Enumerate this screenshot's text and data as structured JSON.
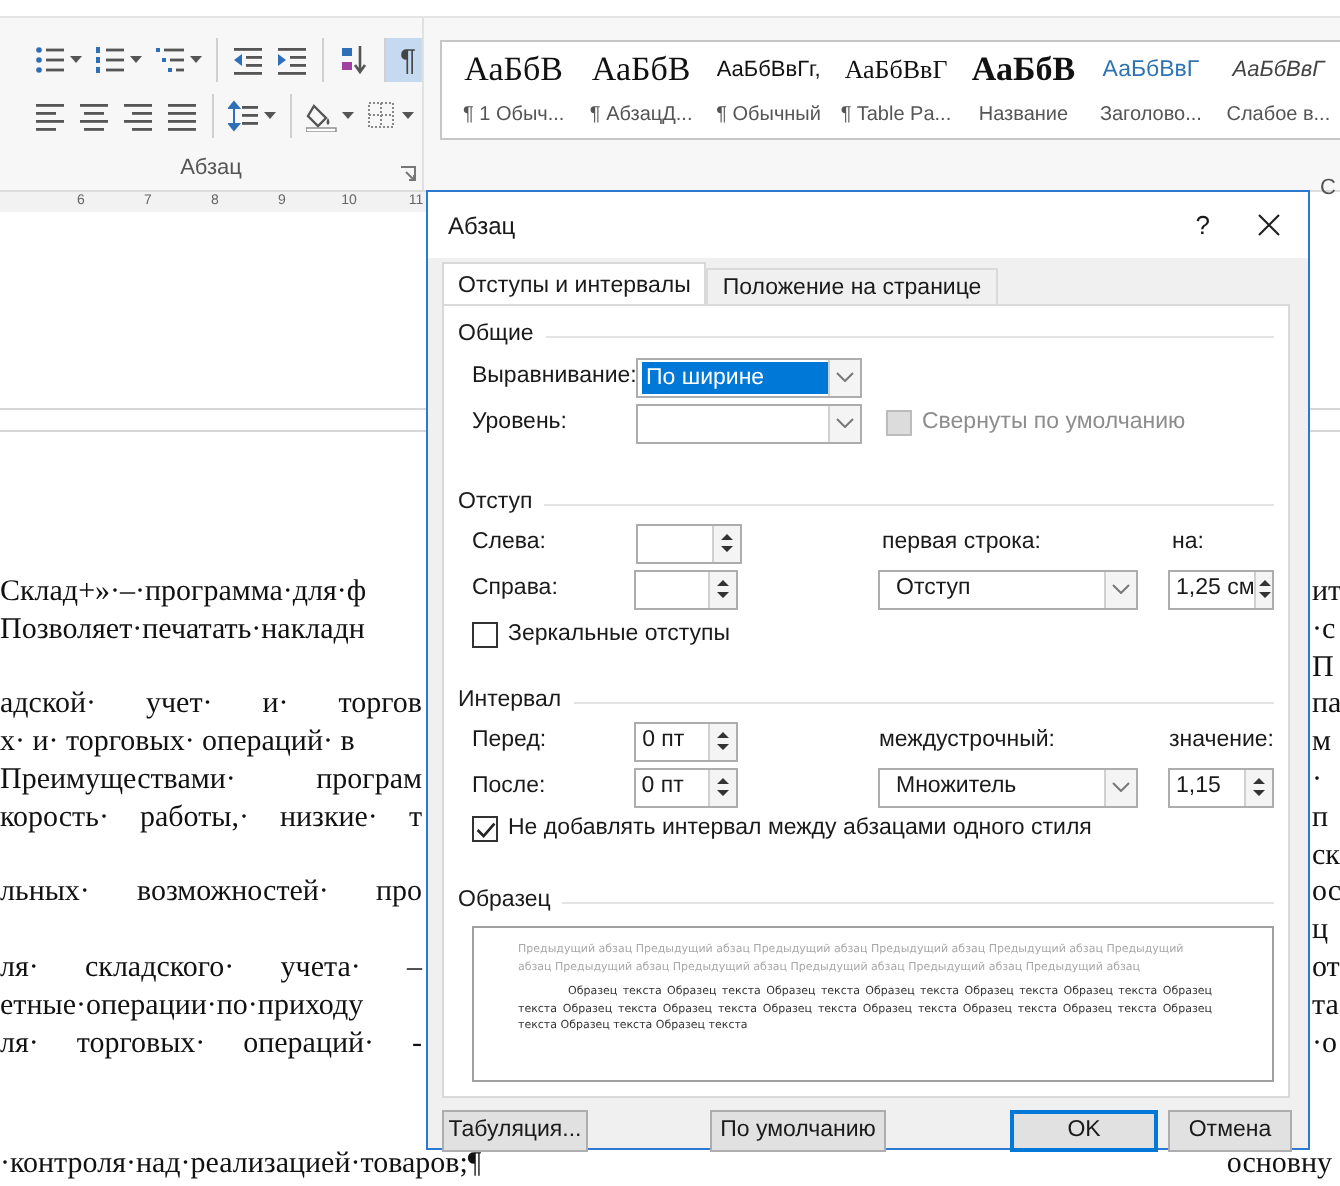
{
  "ribbon": {
    "tools_top": [
      {
        "kind": "bullets",
        "dropdown": true,
        "selected": false,
        "separator_before": false
      },
      {
        "kind": "numbering",
        "dropdown": true,
        "selected": false,
        "separator_before": false
      },
      {
        "kind": "multilevel",
        "dropdown": true,
        "selected": false,
        "separator_before": false
      },
      {
        "kind": "outdent",
        "dropdown": false,
        "selected": false,
        "separator_before": true
      },
      {
        "kind": "indent",
        "dropdown": false,
        "selected": false,
        "separator_before": false
      },
      {
        "kind": "sort",
        "dropdown": false,
        "selected": false,
        "separator_before": true
      },
      {
        "kind": "marks",
        "dropdown": false,
        "selected": true,
        "separator_before": true,
        "glyph": "¶"
      }
    ],
    "tools_bottom": [
      {
        "kind": "align-left",
        "dropdown": false,
        "selected": false,
        "separator_before": false
      },
      {
        "kind": "align-center",
        "dropdown": false,
        "selected": false,
        "separator_before": false
      },
      {
        "kind": "align-right",
        "dropdown": false,
        "selected": false,
        "separator_before": false
      },
      {
        "kind": "justify",
        "dropdown": false,
        "selected": false,
        "separator_before": false
      },
      {
        "kind": "spacing",
        "dropdown": true,
        "selected": false,
        "separator_before": true
      },
      {
        "kind": "shading",
        "dropdown": true,
        "selected": false,
        "separator_before": true
      },
      {
        "kind": "borders",
        "dropdown": true,
        "selected": false,
        "separator_before": false
      }
    ],
    "group_label": "Абзац",
    "styles": [
      {
        "preview": "АаБбВ",
        "name": "¶ 1 Обыч...",
        "kind": "serif"
      },
      {
        "preview": "АаБбВ",
        "name": "¶ АбзацД...",
        "kind": "serif"
      },
      {
        "preview": "АаБбВвГг,",
        "name": "¶ Обычный",
        "kind": "sans"
      },
      {
        "preview": "АаБбВвГ",
        "name": "¶ Table Pa...",
        "kind": "compact"
      },
      {
        "preview": "АаБбВ",
        "name": "Название",
        "kind": "title"
      },
      {
        "preview": "АаБбВвГ",
        "name": "Заголово...",
        "kind": "heading"
      },
      {
        "preview": "АаБбВвГ",
        "name": "Слабое в...",
        "kind": "subtle"
      }
    ],
    "next_group_label": "С"
  },
  "ruler": {
    "numbers": [
      "6",
      "7",
      "8",
      "9",
      "10",
      "11"
    ]
  },
  "document": {
    "rows": [
      {
        "kind": "line",
        "left": "Склад+»·–·программа·для·ф",
        "right": "ит"
      },
      {
        "kind": "line",
        "left": "Позволяет·печатать·накладн",
        "right": "·с"
      },
      {
        "kind": "line",
        "right": "П"
      },
      {
        "kind": "line",
        "left": "адской· учет· и· торгов",
        "justified": true,
        "right": "па"
      },
      {
        "kind": "line",
        "left": "х· и· торговых· операций· в",
        "justified": false,
        "right": "м"
      },
      {
        "kind": "line",
        "left": "Преимуществами· програм",
        "justified": true,
        "right": "·"
      },
      {
        "kind": "line",
        "left": "корость· работы,· низкие· т",
        "justified": true,
        "right": "п"
      },
      {
        "kind": "line",
        "right": "ск"
      },
      {
        "kind": "line",
        "left": "льных· возможностей· про",
        "justified": true,
        "right": "ос"
      },
      {
        "kind": "line",
        "right": "ц"
      },
      {
        "kind": "line",
        "left": "ля· складского· учета· –",
        "justified": true,
        "right": "от"
      },
      {
        "kind": "line",
        "left": "етные·операции·по·приходу",
        "right": "та"
      },
      {
        "kind": "line",
        "left": "ля· торговых· операций· -",
        "justified": true,
        "right": "·о"
      },
      {
        "kind": "blank"
      },
      {
        "kind": "blank"
      },
      {
        "kind": "below_dialog",
        "left": "·контроля·над·реализацией·товаров;¶",
        "right": "основну"
      }
    ]
  },
  "dialog": {
    "title": "Абзац",
    "help": "?",
    "tabs": [
      {
        "label": "Отступы и интервалы",
        "selected": true
      },
      {
        "label": "Положение на странице",
        "selected": false
      }
    ],
    "general": {
      "heading": "Общие",
      "alignment": {
        "label": "Выравнивание:",
        "value": "По ширине",
        "highlighted": true
      },
      "level": {
        "label": "Уровень:"
      },
      "collapsed": {
        "label": "Свернуты по умолчанию",
        "checked": false,
        "disabled": true
      }
    },
    "indent": {
      "heading": "Отступ",
      "left": {
        "label": "Слева:"
      },
      "right": {
        "label": "Справа:"
      },
      "first_line": {
        "label": "первая строка:",
        "value": "Отступ"
      },
      "by": {
        "label": "на:",
        "value": "1,25 см"
      },
      "mirror": {
        "label": "Зеркальные отступы",
        "checked": false,
        "disabled": false
      }
    },
    "spacing": {
      "heading": "Интервал",
      "before": {
        "label": "Перед:",
        "value": "0 пт"
      },
      "after": {
        "label": "После:",
        "value": "0 пт"
      },
      "line": {
        "label": "междустрочный:",
        "value": "Множитель"
      },
      "at": {
        "label": "значение:",
        "value": "1,15"
      },
      "no_space": {
        "label": "Не добавлять интервал между абзацами одного стиля",
        "checked": true,
        "disabled": false
      }
    },
    "preview": {
      "heading": "Образец",
      "previous": "Предыдущий абзац Предыдущий абзац Предыдущий абзац Предыдущий абзац Предыдущий абзац Предыдущий абзац Предыдущий абзац Предыдущий абзац Предыдущий абзац Предыдущий абзац Предыдущий абзац",
      "sample": "Образец текста Образец текста Образец текста Образец текста Образец текста Образец текста Образец текста Образец текста Образец текста Образец текста Образец текста Образец текста Образец текста Образец текста Образец текста Образец текста"
    },
    "buttons": [
      {
        "label": "Табуляция...",
        "default": false
      },
      {
        "label": "По умолчанию",
        "default": false
      },
      {
        "label": "OK",
        "default": true
      },
      {
        "label": "Отмена",
        "default": false
      }
    ]
  }
}
